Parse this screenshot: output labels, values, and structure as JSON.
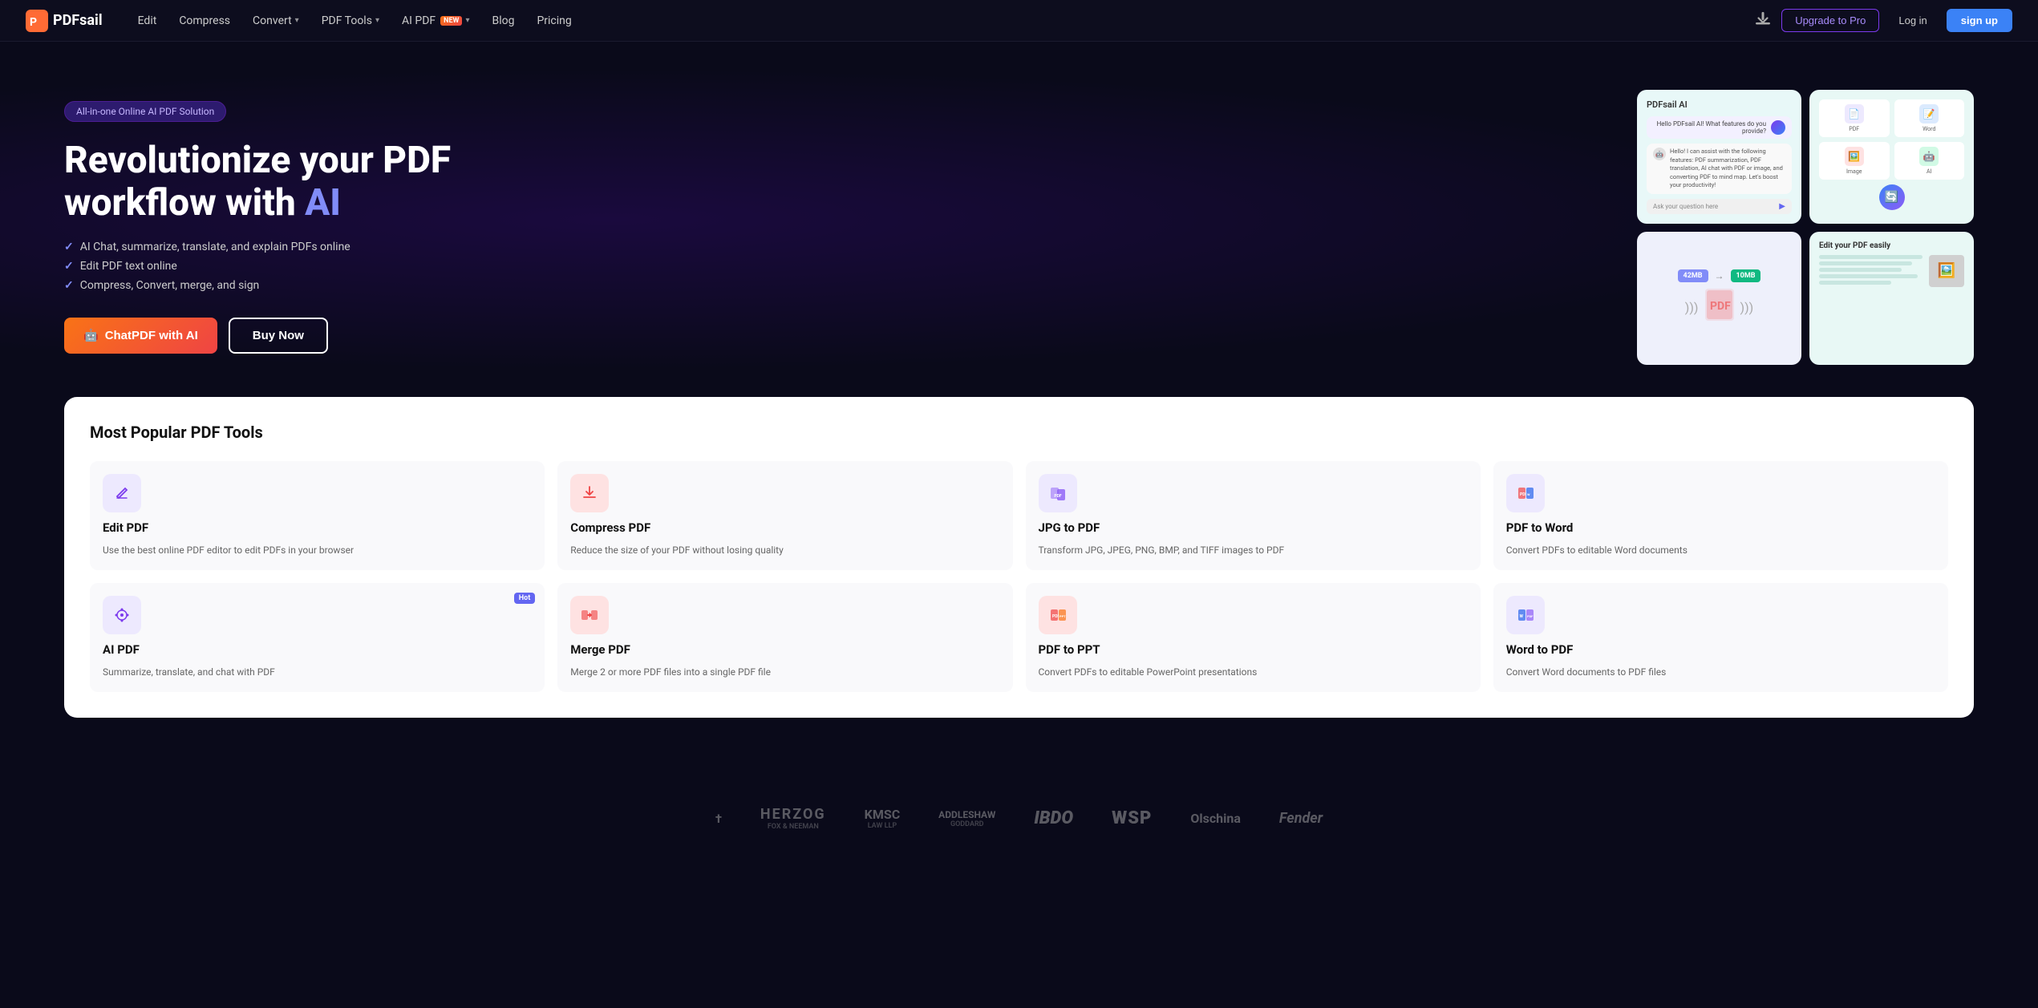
{
  "nav": {
    "logo_text": "PDFsail",
    "links": [
      {
        "label": "Edit",
        "has_dropdown": false
      },
      {
        "label": "Compress",
        "has_dropdown": false
      },
      {
        "label": "Convert",
        "has_dropdown": true
      },
      {
        "label": "PDF Tools",
        "has_dropdown": true
      },
      {
        "label": "AI PDF",
        "has_dropdown": true,
        "badge": "NEW"
      },
      {
        "label": "Blog",
        "has_dropdown": false
      },
      {
        "label": "Pricing",
        "has_dropdown": false
      }
    ],
    "upgrade_label": "Upgrade to Pro",
    "login_label": "Log in",
    "signup_label": "sign up"
  },
  "hero": {
    "badge": "All-in-one Online AI PDF Solution",
    "title_line1": "Revolutionize your PDF",
    "title_line2": "workflow with ",
    "title_ai": "AI",
    "features": [
      "AI Chat, summarize, translate, and explain PDFs online",
      "Edit PDF text online",
      "Compress, Convert, merge, and sign"
    ],
    "btn_chat": "ChatPDF with AI",
    "btn_buy": "Buy Now",
    "ai_card_title": "PDFsail AI",
    "ai_card_user_msg": "Hello PDFsail AI! What features do you provide?",
    "ai_card_bot_msg": "Hello! I can assist with the following features: PDF summarization, PDF translation, AI chat with PDF or image, and converting PDF to mind map. Let's boost your productivity!",
    "ai_card_input_placeholder": "Ask your question here",
    "edit_card_title": "Edit your PDF easily",
    "compress_size_before": "42MB",
    "compress_size_after": "10MB"
  },
  "tools_section": {
    "title": "Most Popular PDF Tools",
    "tools": [
      {
        "icon": "✏️",
        "icon_class": "tool-icon-edit",
        "name": "Edit PDF",
        "desc": "Use the best online PDF editor to edit PDFs in your browser",
        "hot": false
      },
      {
        "icon": "🗜️",
        "icon_class": "tool-icon-compress",
        "name": "Compress PDF",
        "desc": "Reduce the size of your PDF without losing quality",
        "hot": false
      },
      {
        "icon": "🖼️",
        "icon_class": "tool-icon-jpg",
        "name": "JPG to PDF",
        "desc": "Transform JPG, JPEG, PNG, BMP, and TIFF images to PDF",
        "hot": false
      },
      {
        "icon": "📄",
        "icon_class": "tool-icon-word",
        "name": "PDF to Word",
        "desc": "Convert PDFs to editable Word documents",
        "hot": false
      },
      {
        "icon": "🤖",
        "icon_class": "tool-icon-ai",
        "name": "AI PDF",
        "desc": "Summarize, translate, and chat with PDF",
        "hot": true,
        "hot_label": "Hot"
      },
      {
        "icon": "🔗",
        "icon_class": "tool-icon-merge",
        "name": "Merge PDF",
        "desc": "Merge 2 or more PDF files into a single PDF file",
        "hot": false
      },
      {
        "icon": "📊",
        "icon_class": "tool-icon-ppt",
        "name": "PDF to PPT",
        "desc": "Convert PDFs to editable PowerPoint presentations",
        "hot": false
      },
      {
        "icon": "📝",
        "icon_class": "tool-icon-wordpdf",
        "name": "Word to PDF",
        "desc": "Convert Word documents to PDF files",
        "hot": false
      }
    ]
  },
  "logos": [
    {
      "main": "†",
      "sub": ""
    },
    {
      "main": "HERZOG",
      "sub": "FOX & NEEMAN"
    },
    {
      "main": "KMSC",
      "sub": "LAW LLP"
    },
    {
      "main": "ADDLESHAW",
      "sub": "GODDARD"
    },
    {
      "main": "IBDO",
      "sub": ""
    },
    {
      "main": "WSP",
      "sub": ""
    },
    {
      "main": "Olschina",
      "sub": ""
    },
    {
      "main": "Fender",
      "sub": ""
    }
  ]
}
